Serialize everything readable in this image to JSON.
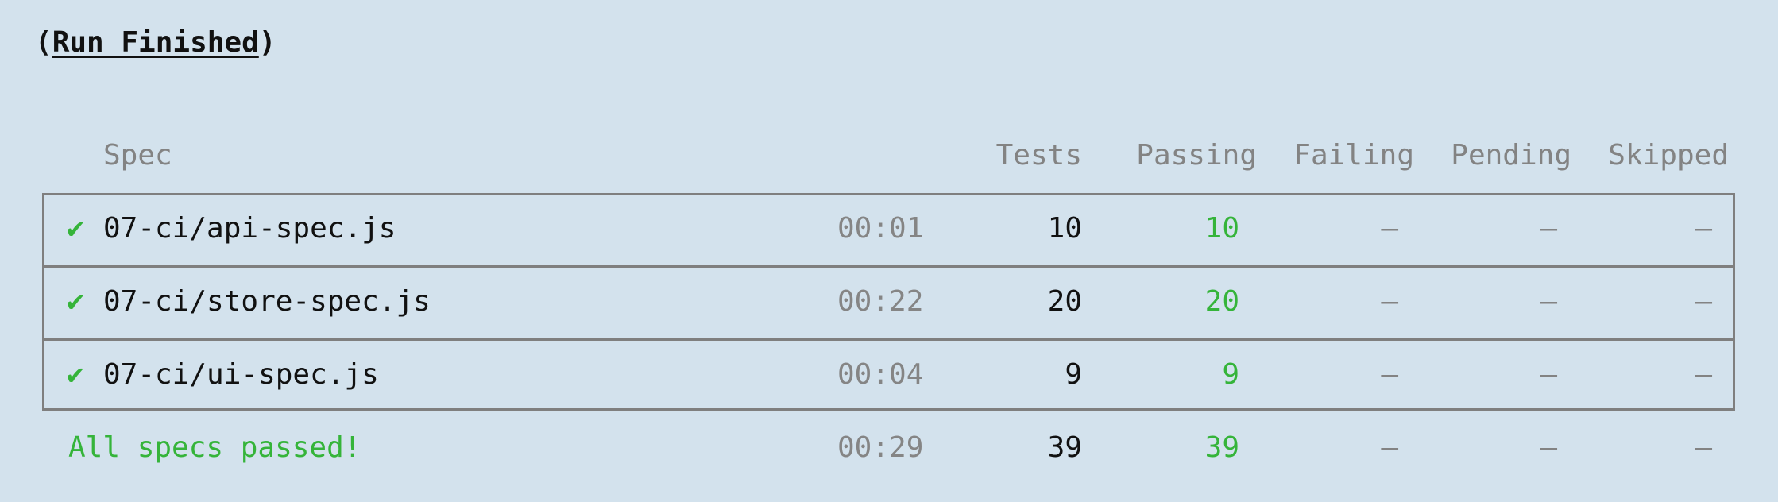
{
  "title": {
    "open": "(",
    "label": "Run Finished",
    "close": ")"
  },
  "header": {
    "spec": "Spec",
    "tests": "Tests",
    "passing": "Passing",
    "failing": "Failing",
    "pending": "Pending",
    "skipped": "Skipped"
  },
  "rows": [
    {
      "check": "✔",
      "spec": "07-ci/api-spec.js",
      "duration": "00:01",
      "tests": "10",
      "passing": "10",
      "failing": "–",
      "pending": "–",
      "skipped": "–"
    },
    {
      "check": "✔",
      "spec": "07-ci/store-spec.js",
      "duration": "00:22",
      "tests": "20",
      "passing": "20",
      "failing": "–",
      "pending": "–",
      "skipped": "–"
    },
    {
      "check": "✔",
      "spec": "07-ci/ui-spec.js",
      "duration": "00:04",
      "tests": "9",
      "passing": "9",
      "failing": "–",
      "pending": "–",
      "skipped": "–"
    }
  ],
  "summary": {
    "label": "All specs passed!",
    "duration": "00:29",
    "tests": "39",
    "passing": "39",
    "failing": "–",
    "pending": "–",
    "skipped": "–"
  },
  "colors": {
    "background": "#d3e2ed",
    "pass": "#35b43a",
    "muted": "#838383",
    "border": "#7f7f7f"
  }
}
